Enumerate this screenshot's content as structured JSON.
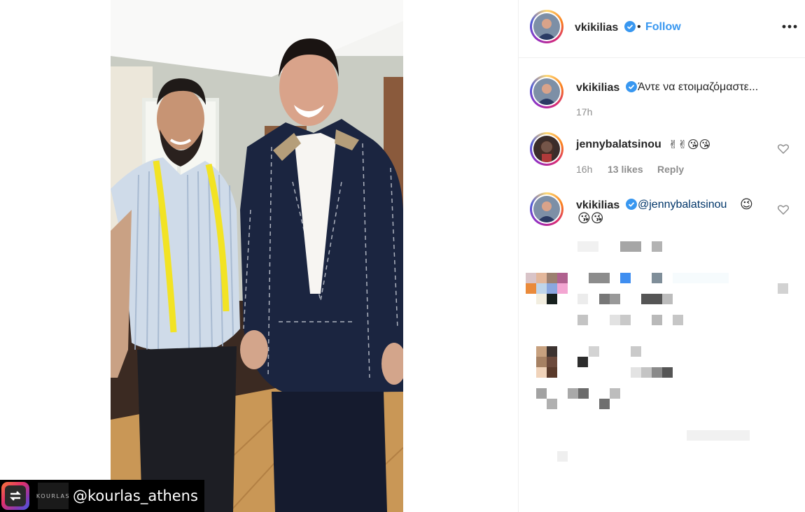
{
  "post_header": {
    "username": "vkikilias",
    "separator": "•",
    "follow_label": "Follow",
    "more_icon": "more-horizontal-icon"
  },
  "caption": {
    "username": "vkikilias",
    "text": "Άντε να ετοιμαζόμαστε...",
    "time": "17h"
  },
  "comments": [
    {
      "username": "jennybalatsinou",
      "text": "✌✌😘😘",
      "time": "16h",
      "likes": "13 likes",
      "reply_label": "Reply"
    },
    {
      "username": "vkikilias",
      "mention": "@jennybalatsinou",
      "emoji_line1": "😉",
      "emoji_line2": "😘😘"
    }
  ],
  "media": {
    "repost_handle": "@kourlas_athens",
    "repost_logo_text": "KOURLAS"
  },
  "colors": {
    "link_blue": "#3897f0",
    "verified_blue": "#3897f0",
    "text_primary": "#262626",
    "text_secondary": "#8e8e8e"
  }
}
